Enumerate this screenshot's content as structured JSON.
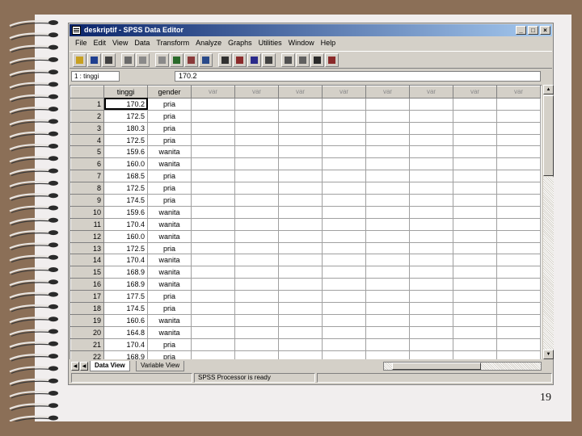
{
  "window": {
    "title": "deskriptif - SPSS Data Editor",
    "min": "_",
    "max": "□",
    "close": "×"
  },
  "menu": [
    "File",
    "Edit",
    "View",
    "Data",
    "Transform",
    "Analyze",
    "Graphs",
    "Utilities",
    "Window",
    "Help"
  ],
  "toolbar_icons": [
    "open-icon",
    "save-icon",
    "print-icon",
    "dialog-recall-icon",
    "undo-icon",
    "redo-icon",
    "goto-chart-icon",
    "goto-case-icon",
    "variables-icon",
    "find-icon",
    "insert-case-icon",
    "insert-variable-icon",
    "split-file-icon",
    "weight-cases-icon",
    "select-cases-icon",
    "value-labels-icon",
    "use-sets-icon"
  ],
  "cell_editor": {
    "ref": "1 : tinggi",
    "value": "170.2"
  },
  "columns": [
    "tinggi",
    "gender",
    "var",
    "var",
    "var",
    "var",
    "var",
    "var",
    "var",
    "var"
  ],
  "rows": [
    [
      "1",
      "170.2",
      "pria"
    ],
    [
      "2",
      "172.5",
      "pria"
    ],
    [
      "3",
      "180.3",
      "pria"
    ],
    [
      "4",
      "172.5",
      "pria"
    ],
    [
      "5",
      "159.6",
      "wanita"
    ],
    [
      "6",
      "160.0",
      "wanita"
    ],
    [
      "7",
      "168.5",
      "pria"
    ],
    [
      "8",
      "172.5",
      "pria"
    ],
    [
      "9",
      "174.5",
      "pria"
    ],
    [
      "10",
      "159.6",
      "wanita"
    ],
    [
      "11",
      "170.4",
      "wanita"
    ],
    [
      "12",
      "160.0",
      "wanita"
    ],
    [
      "13",
      "172.5",
      "pria"
    ],
    [
      "14",
      "170.4",
      "wanita"
    ],
    [
      "15",
      "168.9",
      "wanita"
    ],
    [
      "16",
      "168.9",
      "wanita"
    ],
    [
      "17",
      "177.5",
      "pria"
    ],
    [
      "18",
      "174.5",
      "pria"
    ],
    [
      "19",
      "160.6",
      "wanita"
    ],
    [
      "20",
      "164.8",
      "wanita"
    ],
    [
      "21",
      "170.4",
      "pria"
    ],
    [
      "22",
      "168.9",
      "pria"
    ]
  ],
  "tabs": {
    "data_view": "Data View",
    "variable_view": "Variable View"
  },
  "status": {
    "processor": "SPSS Processor  is ready"
  },
  "slide": {
    "page_number": "19"
  }
}
